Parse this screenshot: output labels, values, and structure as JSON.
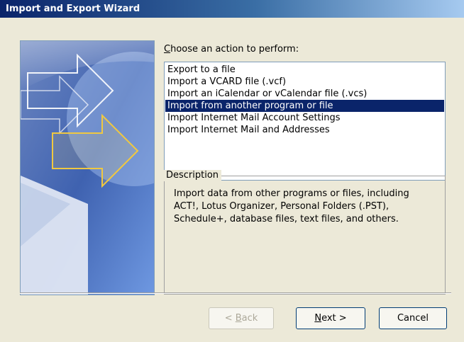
{
  "window": {
    "title": "Import and Export Wizard"
  },
  "prompt": {
    "mnemonic": "C",
    "rest": "hoose an action to perform:"
  },
  "actions": [
    {
      "label": "Export to a file",
      "selected": false
    },
    {
      "label": "Import a VCARD file (.vcf)",
      "selected": false
    },
    {
      "label": "Import an iCalendar or vCalendar file (.vcs)",
      "selected": false
    },
    {
      "label": "Import from another program or file",
      "selected": true
    },
    {
      "label": "Import Internet Mail Account Settings",
      "selected": false
    },
    {
      "label": "Import Internet Mail and Addresses",
      "selected": false
    }
  ],
  "description": {
    "legend": "Description",
    "text": "Import data from other programs or files, including ACT!, Lotus Organizer, Personal Folders (.PST), Schedule+, database files, text files, and others."
  },
  "buttons": {
    "back": {
      "prefix": "< ",
      "mnemonic": "B",
      "rest": "ack",
      "enabled": false
    },
    "next": {
      "mnemonic": "N",
      "rest": "ext >",
      "enabled": true
    },
    "cancel": {
      "label": "Cancel",
      "enabled": true
    }
  },
  "colors": {
    "selection": "#0a246a",
    "panel": "#ece9d8"
  }
}
